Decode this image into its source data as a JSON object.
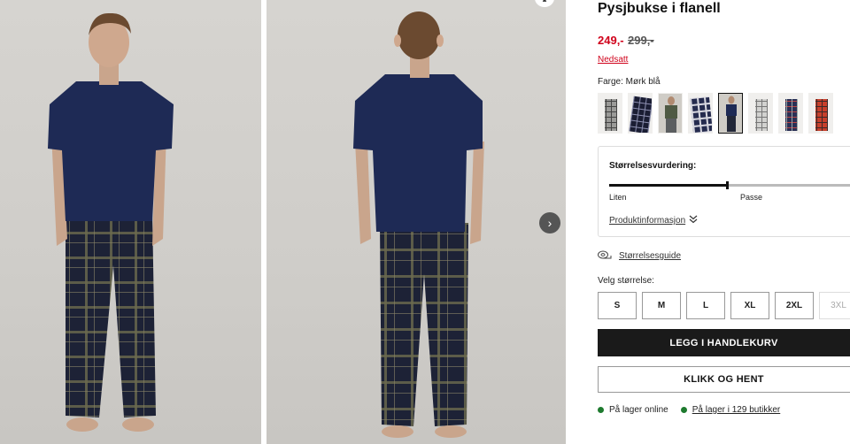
{
  "product": {
    "title": "Pysjbukse i flanell",
    "price_now": "249,-",
    "price_old": "299,-",
    "sale_label": "Nedsatt",
    "color_label": "Farge: Mørk blå",
    "swatches": [
      "grey-check",
      "navy-check",
      "model-green",
      "navy-check-2",
      "model-navy",
      "light-grey-check",
      "navy-red-check",
      "red-check"
    ],
    "selected_swatch_index": 4
  },
  "fit": {
    "label": "Størrelsesvurdering:",
    "left_label": "Liten",
    "mid_label": "Passe",
    "level_fraction": 0.46,
    "info_link": "Produktinformasjon"
  },
  "size": {
    "guide_label": "Størrelsesguide",
    "choose_label": "Velg størrelse:",
    "options": [
      "S",
      "M",
      "L",
      "XL",
      "2XL",
      "3XL"
    ]
  },
  "actions": {
    "add_to_cart": "LEGG I HANDLEKURV",
    "click_collect": "KLIKK OG HENT"
  },
  "stock": {
    "online": "På lager online",
    "stores": "På lager i 129 butikker"
  },
  "colors": {
    "sale_red": "#d0021b",
    "in_stock_green": "#1e7a2e",
    "primary_button": "#1a1a1a"
  },
  "icons": {
    "carousel_next": "chevron-right-icon",
    "size_guide": "tape-measure-icon",
    "info_expand": "double-chevron-down-icon"
  }
}
